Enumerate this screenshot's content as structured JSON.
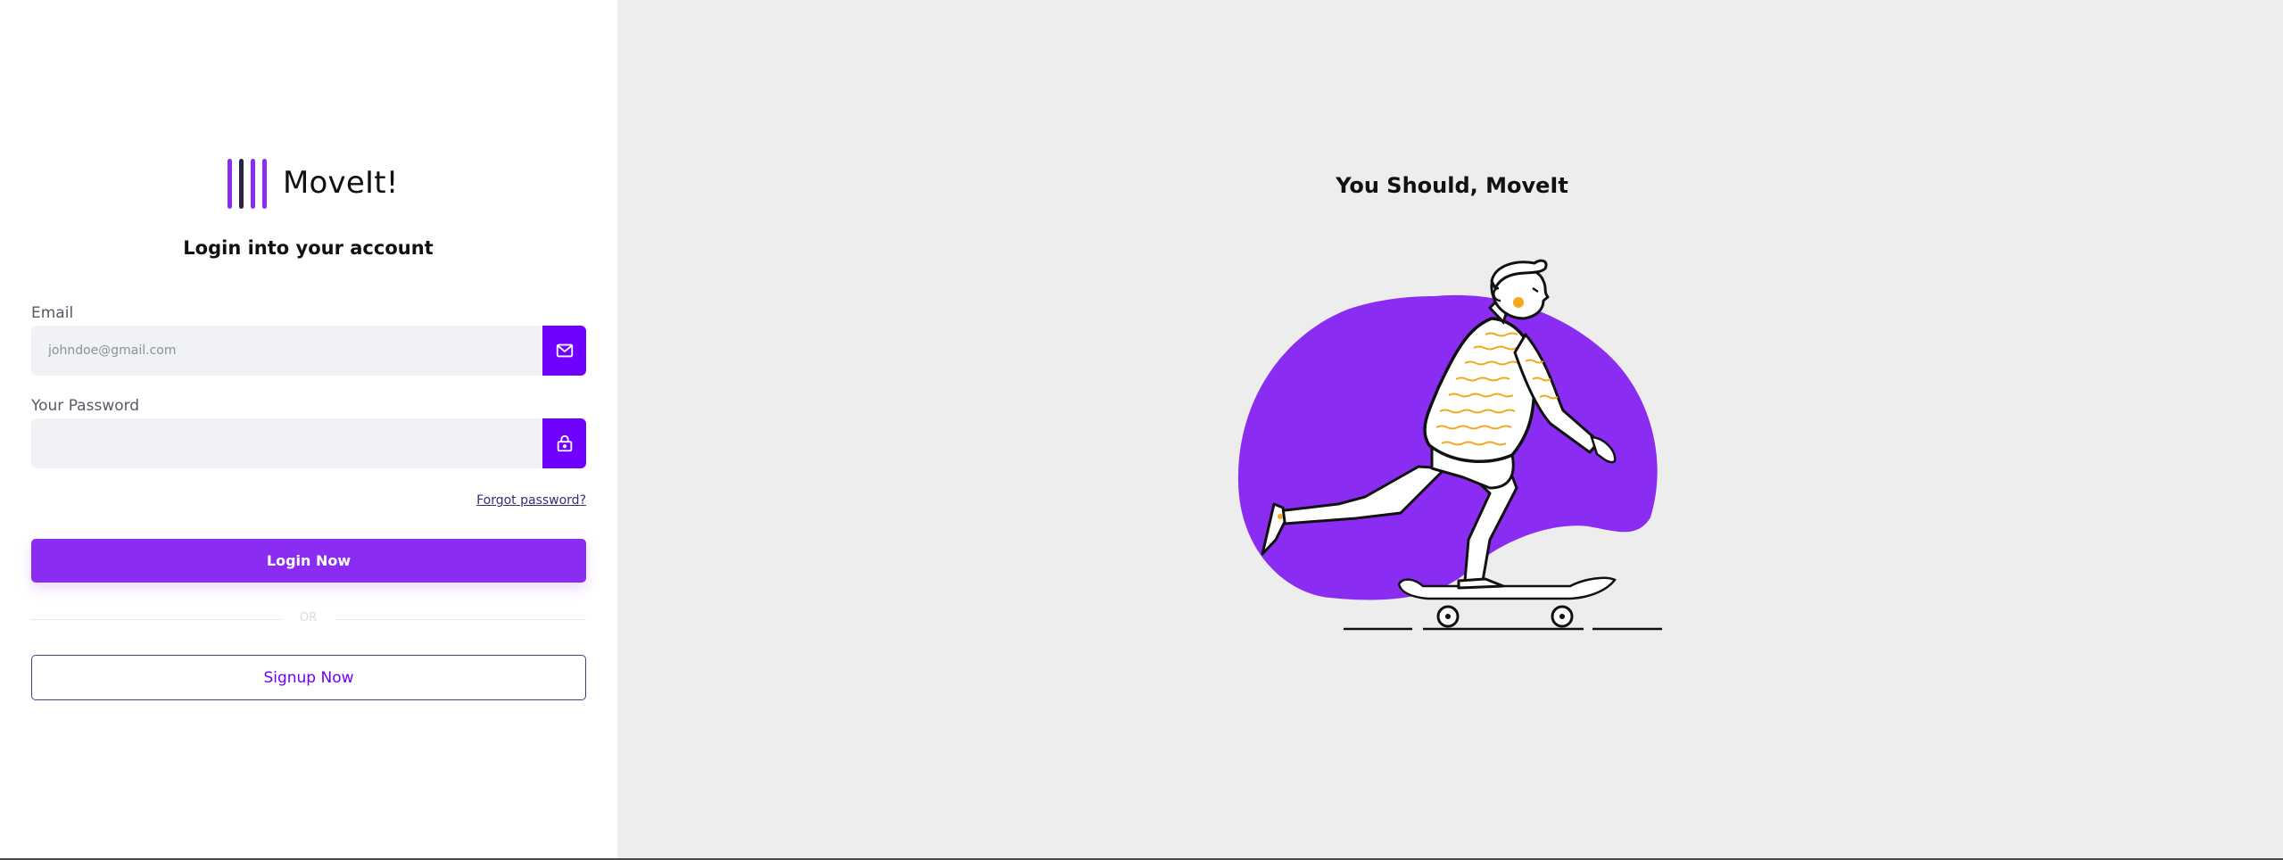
{
  "brand": {
    "name": "MoveIt!"
  },
  "login": {
    "title": "Login into your account",
    "email_label": "Email",
    "email_placeholder": "johndoe@gmail.com",
    "email_value": "",
    "password_label": "Your Password",
    "password_placeholder": "",
    "password_value": "",
    "forgot_link": "Forgot password?",
    "login_button": "Login Now",
    "or_text": "OR",
    "signup_button": "Signup Now"
  },
  "hero": {
    "title": "You Should, MoveIt"
  },
  "icons": {
    "email": "mail-icon",
    "password": "lock-icon"
  },
  "colors": {
    "accent": "#7000ff",
    "primary_button": "#8a2cf2",
    "blob": "#8a2cf2",
    "panel_background": "#ededed",
    "input_background": "#f1f2f5",
    "stripes": "#f4a81c"
  }
}
